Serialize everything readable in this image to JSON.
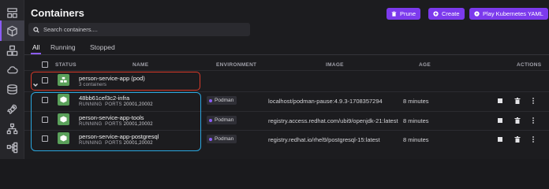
{
  "sidebar": {
    "items": [
      {
        "icon": "dashboard-icon",
        "active": false
      },
      {
        "icon": "container-cube-icon",
        "active": true
      },
      {
        "icon": "pods-icon",
        "active": false
      },
      {
        "icon": "cloud-icon",
        "active": false
      },
      {
        "icon": "volumes-icon",
        "active": false
      },
      {
        "icon": "rocket-icon",
        "active": false
      },
      {
        "icon": "network-icon",
        "active": false
      },
      {
        "icon": "extensions-icon",
        "active": false
      }
    ]
  },
  "header": {
    "title": "Containers",
    "prune_label": "Prune",
    "create_label": "Create",
    "kube_label": "Play Kubernetes YAML"
  },
  "search": {
    "placeholder": "Search containers...."
  },
  "tabs": [
    {
      "label": "All",
      "active": true
    },
    {
      "label": "Running",
      "active": false
    },
    {
      "label": "Stopped",
      "active": false
    }
  ],
  "columns": {
    "status": "STATUS",
    "name": "NAME",
    "environment": "ENVIRONMENT",
    "image": "IMAGE",
    "age": "AGE",
    "actions": "ACTIONS"
  },
  "pod": {
    "name": "person-service-app (pod)",
    "count": "3 containers"
  },
  "containers": [
    {
      "name": "48bb61cef3c2-infra",
      "state": "RUNNING",
      "ports_label": "PORTS",
      "ports": "20001,20002",
      "environment": "Podman",
      "image": "localhost/podman-pause:4.9.3-1708357294",
      "age": "8 minutes"
    },
    {
      "name": "person-service-app-tools",
      "state": "RUNNING",
      "ports_label": "PORTS",
      "ports": "20001,20002",
      "environment": "Podman",
      "image": "registry.access.redhat.com/ubi9/openjdk-21:latest",
      "age": "8 minutes"
    },
    {
      "name": "person-service-app-postgresql",
      "state": "RUNNING",
      "ports_label": "PORTS",
      "ports": "20001,20002",
      "environment": "Podman",
      "image": "registry.redhat.io/rhel9/postgresql-15:latest",
      "age": "8 minutes"
    }
  ],
  "colors": {
    "accent": "#7c3aed",
    "running_green": "#5aa05a",
    "highlight_red": "#d93a2a",
    "highlight_blue": "#2aa6de"
  }
}
